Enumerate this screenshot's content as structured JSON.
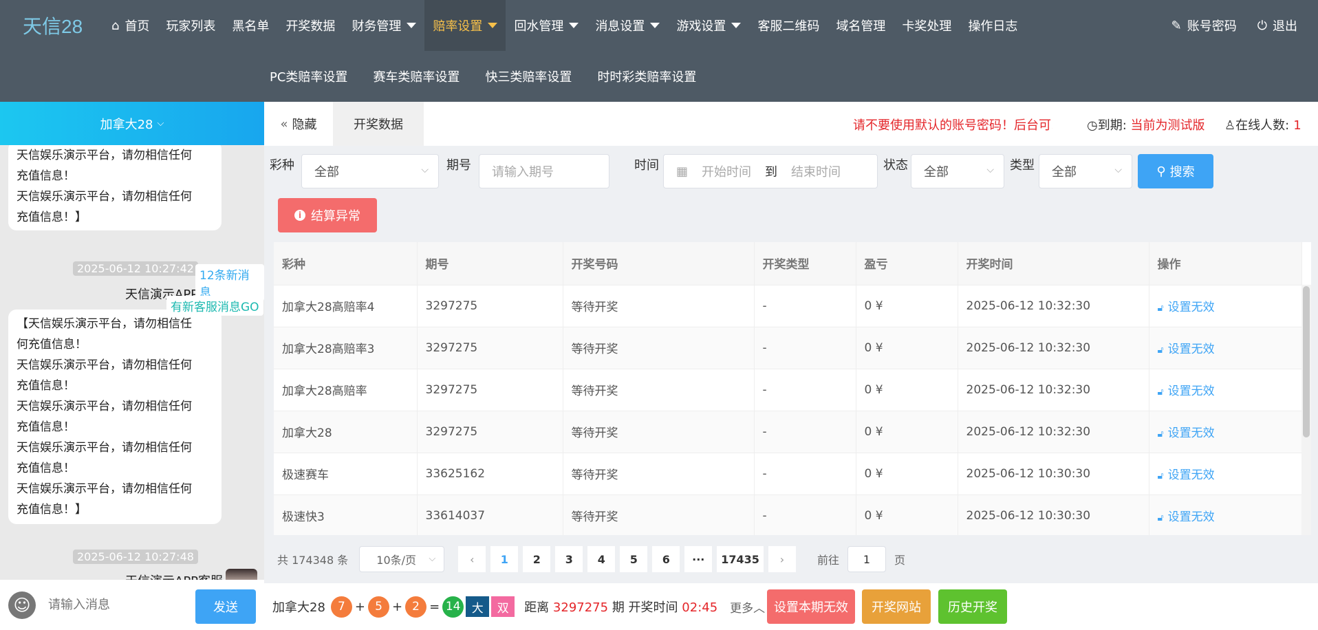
{
  "app": {
    "logo": "天信28"
  },
  "nav": {
    "items": [
      {
        "label": "首页",
        "icon": "home-icon",
        "caret": false,
        "active": false
      },
      {
        "label": "玩家列表",
        "caret": false,
        "active": false
      },
      {
        "label": "黑名单",
        "caret": false,
        "active": false
      },
      {
        "label": "开奖数据",
        "caret": false,
        "active": false
      },
      {
        "label": "财务管理",
        "caret": true,
        "active": false
      },
      {
        "label": "赔率设置",
        "caret": true,
        "active": true
      },
      {
        "label": "回水管理",
        "caret": true,
        "active": false
      },
      {
        "label": "消息设置",
        "caret": true,
        "active": false
      },
      {
        "label": "游戏设置",
        "caret": true,
        "active": false
      },
      {
        "label": "客服二维码",
        "caret": false,
        "active": false
      },
      {
        "label": "域名管理",
        "caret": false,
        "active": false
      },
      {
        "label": "卡奖处理",
        "caret": false,
        "active": false
      },
      {
        "label": "操作日志",
        "caret": false,
        "active": false
      }
    ],
    "right": {
      "account": "账号密码",
      "logout": "退出"
    },
    "accent": "#f7c04a"
  },
  "subnav": {
    "items": [
      "PC类赔率设置",
      "赛车类赔率设置",
      "快三类赔率设置",
      "时时彩类赔率设置"
    ]
  },
  "chat": {
    "header": "加拿大28",
    "new_messages": "12条新消息",
    "new_kf": "有新客服消息GO",
    "messages": [
      {
        "lines": [
          "天信娱乐演示平台，请勿相信任何",
          "充值信息！",
          "天信娱乐演示平台，请勿相信任何",
          "充值信息！】"
        ]
      },
      {
        "time": "2025-06-12 10:27:42",
        "sender": "天信演示APP客服",
        "lines": [
          "【天信娱乐演示平台，请勿相信任",
          "何充值信息！",
          "天信娱乐演示平台，请勿相信任何",
          "充值信息！",
          "天信娱乐演示平台，请勿相信任何",
          "充值信息！",
          "天信娱乐演示平台，请勿相信任何",
          "充值信息！",
          "天信娱乐演示平台，请勿相信任何",
          "充值信息！】"
        ]
      },
      {
        "time": "2025-06-12 10:27:48",
        "sender": "天信演示APP客服"
      }
    ],
    "input_placeholder": "请输入消息",
    "send": "发送"
  },
  "tabs": {
    "hide": "隐藏",
    "current": "开奖数据"
  },
  "notice": {
    "warning": "请不要使用默认的账号密码！后台可以修改",
    "expire_label": "到期:",
    "expire_value": "当前为测试版",
    "online_label": "在线人数:",
    "online_value": "1"
  },
  "filters": {
    "lottery_label": "彩种",
    "lottery_value": "全部",
    "issue_label": "期号",
    "issue_placeholder": "请输入期号",
    "time_label": "时间",
    "start_placeholder": "开始时间",
    "to": "到",
    "end_placeholder": "结束时间",
    "status_label": "状态",
    "status_value": "全部",
    "type_label": "类型",
    "type_value": "全部",
    "search": "搜索",
    "settle_error": "结算异常"
  },
  "table": {
    "columns": [
      "彩种",
      "期号",
      "开奖号码",
      "开奖类型",
      "盈亏",
      "开奖时间",
      "操作"
    ],
    "rows": [
      [
        "加拿大28高赔率4",
        "3297275",
        "等待开奖",
        "-",
        "0 ¥",
        "2025-06-12 10:32:30",
        "设置无效"
      ],
      [
        "加拿大28高赔率3",
        "3297275",
        "等待开奖",
        "-",
        "0 ¥",
        "2025-06-12 10:32:30",
        "设置无效"
      ],
      [
        "加拿大28高赔率",
        "3297275",
        "等待开奖",
        "-",
        "0 ¥",
        "2025-06-12 10:32:30",
        "设置无效"
      ],
      [
        "加拿大28",
        "3297275",
        "等待开奖",
        "-",
        "0 ¥",
        "2025-06-12 10:32:30",
        "设置无效"
      ],
      [
        "极速赛车",
        "33625162",
        "等待开奖",
        "-",
        "0 ¥",
        "2025-06-12 10:30:30",
        "设置无效"
      ],
      [
        "极速快3",
        "33614037",
        "等待开奖",
        "-",
        "0 ¥",
        "2025-06-12 10:30:30",
        "设置无效"
      ]
    ]
  },
  "pager": {
    "total": "共 174348 条",
    "page_size": "10条/页",
    "pages": [
      "1",
      "2",
      "3",
      "4",
      "5",
      "6",
      "···",
      "17435"
    ],
    "current": "1",
    "goto_label": "前往",
    "goto_value": "1",
    "page_suffix": "页"
  },
  "bottom": {
    "name": "加拿大28",
    "balls": [
      "7",
      "5",
      "2"
    ],
    "sum": "14",
    "size": "大",
    "parity": "双",
    "countdown_prefix": "距离",
    "issue": "3297275",
    "countdown_mid": "期 开奖时间",
    "countdown": "02:45",
    "more": "更多",
    "btn_invalid": "设置本期无效",
    "btn_site": "开奖网站",
    "btn_history": "历史开奖",
    "colors": {
      "invalid": "#f46c6c",
      "site": "#e8a13a",
      "history": "#5ec22f"
    }
  }
}
